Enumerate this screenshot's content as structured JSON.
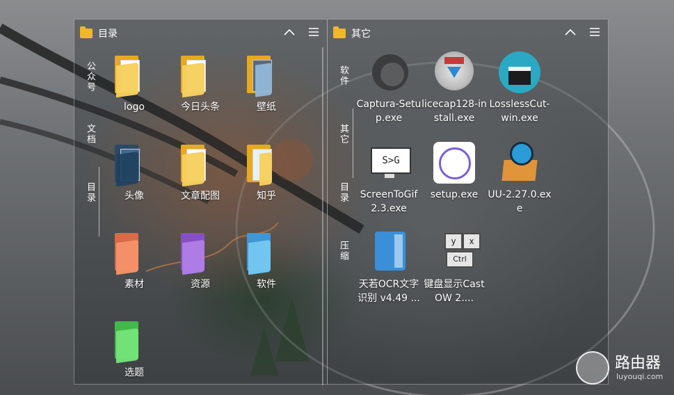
{
  "left_panel": {
    "title": "目录",
    "tabs": [
      "公众号",
      "文档",
      "目录"
    ],
    "items": [
      {
        "label": "logo",
        "icon": "folder-documents-icon"
      },
      {
        "label": "今日头条",
        "icon": "folder-documents-icon"
      },
      {
        "label": "壁纸",
        "icon": "folder-wallpaper-icon"
      },
      {
        "label": "头像",
        "icon": "folder-image-icon"
      },
      {
        "label": "文章配图",
        "icon": "folder-documents-icon"
      },
      {
        "label": "知乎",
        "icon": "folder-image-icon"
      },
      {
        "label": "素材",
        "icon": "folder-orange-icon"
      },
      {
        "label": "资源",
        "icon": "folder-purple-icon"
      },
      {
        "label": "软件",
        "icon": "folder-blue-icon"
      },
      {
        "label": "选题",
        "icon": "folder-green-icon"
      }
    ]
  },
  "right_panel": {
    "title": "其它",
    "tabs": [
      "软件",
      "其它",
      "目录",
      "压缩"
    ],
    "items": [
      {
        "label": "Captura-Setup.exe",
        "icon": "captura-icon"
      },
      {
        "label": "licecap128-install.exe",
        "icon": "licecap-icon"
      },
      {
        "label": "LosslessCut-win.exe",
        "icon": "losslesscut-icon"
      },
      {
        "label": "ScreenToGif 2.3.exe",
        "icon": "screentogif-icon"
      },
      {
        "label": "setup.exe",
        "icon": "setup-ring-icon"
      },
      {
        "label": "UU-2.27.0.exe",
        "icon": "uu-accelerator-icon"
      },
      {
        "label": "天若OCR文字识别 v4.49 ...",
        "icon": "ocr-notebook-icon"
      },
      {
        "label": "键盘显示CastOW 2....",
        "icon": "keyboard-keys-icon"
      }
    ]
  },
  "watermark": {
    "name": "路由器",
    "url": "luyouqi.com"
  },
  "colors": {
    "folder_yellow": "#f0b72c",
    "orange": "#f08860",
    "purple": "#a06ad8",
    "blue": "#5ab4ea",
    "green": "#62d66a"
  }
}
